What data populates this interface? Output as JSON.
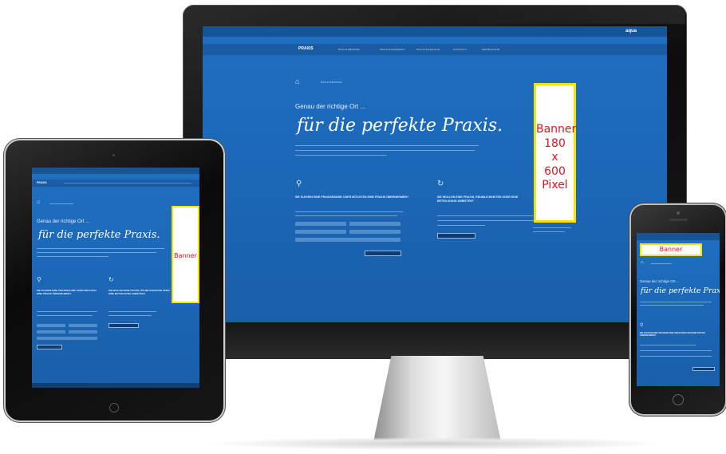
{
  "monitor": {
    "nav": {
      "logo": "PRAXIS",
      "top_right": "aqua",
      "menu_items": [
        "PRAXISBÖRSE",
        "PRAXISANGEBOT",
        "PRAXISGESUCH",
        "KONTAKT",
        "IMPRESSUM"
      ]
    },
    "brand_tagline": "PRAXISBÖRSE",
    "heading": "Genau der richtige Ort ...",
    "script_title": "für die perfekte Praxis.",
    "col1_heading": "SIE SUCHEN EINE PRAXISRÄUME ODER MÖCHTEN EINE PRAXIS ÜBERNEHMEN?",
    "col2_heading": "SIE WOLLEN EINE PRAXIS, RÄUMLICHKEITEN ODER EINE BETEILIGUNG ANBIETEN?",
    "col1_button": "ANGEBOTE FINDEN",
    "col2_button": "ANGEBOT ERSTELLEN",
    "banner": {
      "line1": "Banner",
      "line2": "180",
      "line3": "x",
      "line4": "600",
      "line5": "Pixel"
    }
  },
  "tablet": {
    "logo": "PRAXIS",
    "heading": "Genau der richtige Ort ...",
    "script_title": "für die perfekte Praxis.",
    "col1_heading": "SIE SUCHEN EINE PRAXISRÄUME ODER MÖCHTEN EINE PRAXIS ÜBERNEHMEN?",
    "col2_heading": "SIE WOLLEN EINE PRAXIS, RÄUMLICHKEITEN ODER EINE BETEILIGUNG ANBIETEN?",
    "banner": "Banner"
  },
  "phone": {
    "banner": "Banner",
    "heading": "Genau der richtige Ort ...",
    "script_title": "für die perfekte Praxis.",
    "col_heading": "SIE SUCHEN EINE PRAXISRÄUME ODER MÖCHTEN EINE PRAXIS ÜBERNEHMEN?"
  },
  "colors": {
    "screen_blue": "#1f6fc0",
    "banner_border": "#f3e500",
    "banner_text": "#e0141e",
    "device_black": "#111111"
  }
}
